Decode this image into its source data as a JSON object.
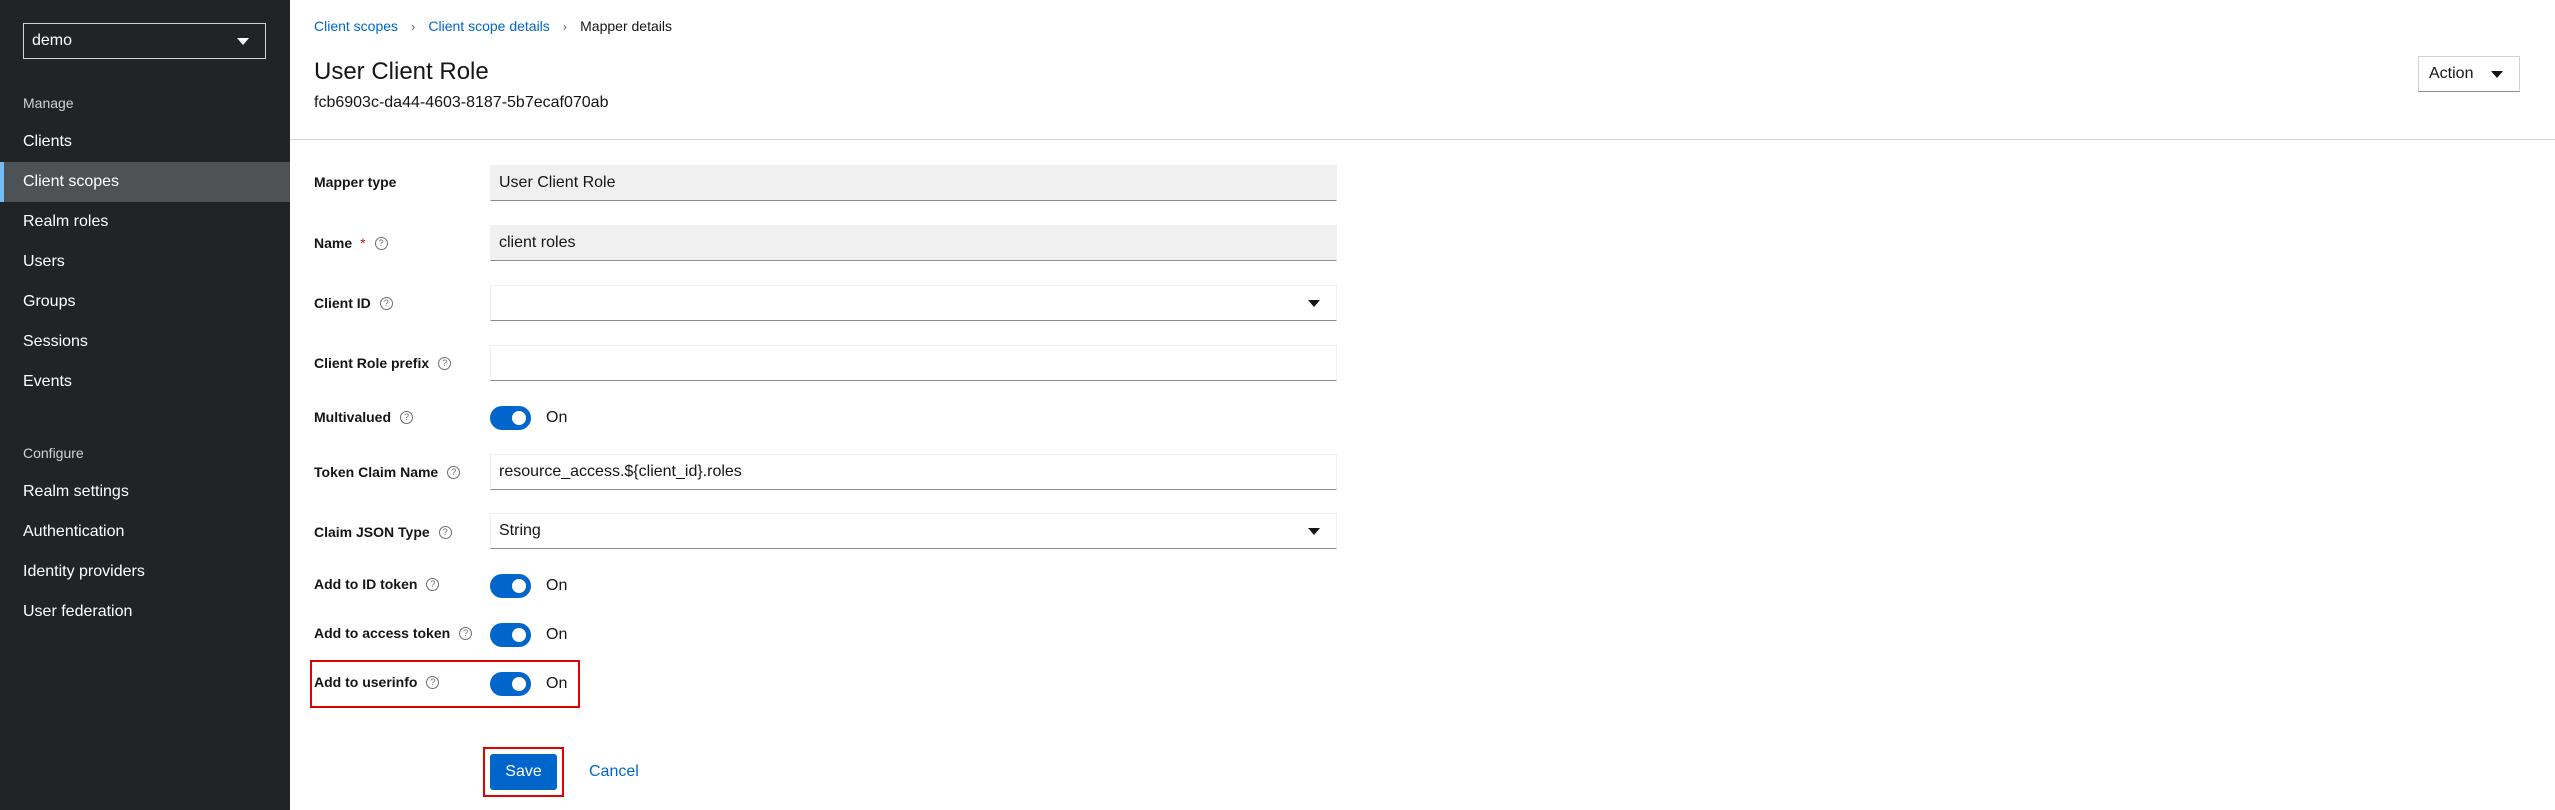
{
  "sidebar": {
    "realm": "demo",
    "manage_heading": "Manage",
    "manage_items": [
      {
        "label": "Clients"
      },
      {
        "label": "Client scopes"
      },
      {
        "label": "Realm roles"
      },
      {
        "label": "Users"
      },
      {
        "label": "Groups"
      },
      {
        "label": "Sessions"
      },
      {
        "label": "Events"
      }
    ],
    "configure_heading": "Configure",
    "configure_items": [
      {
        "label": "Realm settings"
      },
      {
        "label": "Authentication"
      },
      {
        "label": "Identity providers"
      },
      {
        "label": "User federation"
      }
    ],
    "active_item": "Client scopes"
  },
  "breadcrumb": {
    "items": [
      {
        "label": "Client scopes"
      },
      {
        "label": "Client scope details"
      }
    ],
    "current": "Mapper details"
  },
  "header": {
    "title": "User Client Role",
    "subtitle": "fcb6903c-da44-4603-8187-5b7ecaf070ab",
    "action_label": "Action"
  },
  "form": {
    "mapper_type": {
      "label": "Mapper type",
      "value": "User Client Role"
    },
    "name": {
      "label": "Name",
      "required": "*",
      "value": "client roles"
    },
    "client_id": {
      "label": "Client ID",
      "value": ""
    },
    "client_role_prefix": {
      "label": "Client Role prefix",
      "value": ""
    },
    "multivalued": {
      "label": "Multivalued",
      "state": "On"
    },
    "token_claim_name": {
      "label": "Token Claim Name",
      "value": "resource_access.${client_id}.roles"
    },
    "claim_json_type": {
      "label": "Claim JSON Type",
      "value": "String"
    },
    "add_to_id_token": {
      "label": "Add to ID token",
      "state": "On"
    },
    "add_to_access_token": {
      "label": "Add to access token",
      "state": "On"
    },
    "add_to_userinfo": {
      "label": "Add to userinfo",
      "state": "On"
    }
  },
  "buttons": {
    "save": "Save",
    "cancel": "Cancel"
  },
  "colors": {
    "sidebar_bg": "#212427",
    "active_nav_bg": "#4f5255",
    "active_nav_accent": "#73bcf7",
    "primary": "#0066cc",
    "highlight": "#e00000"
  }
}
